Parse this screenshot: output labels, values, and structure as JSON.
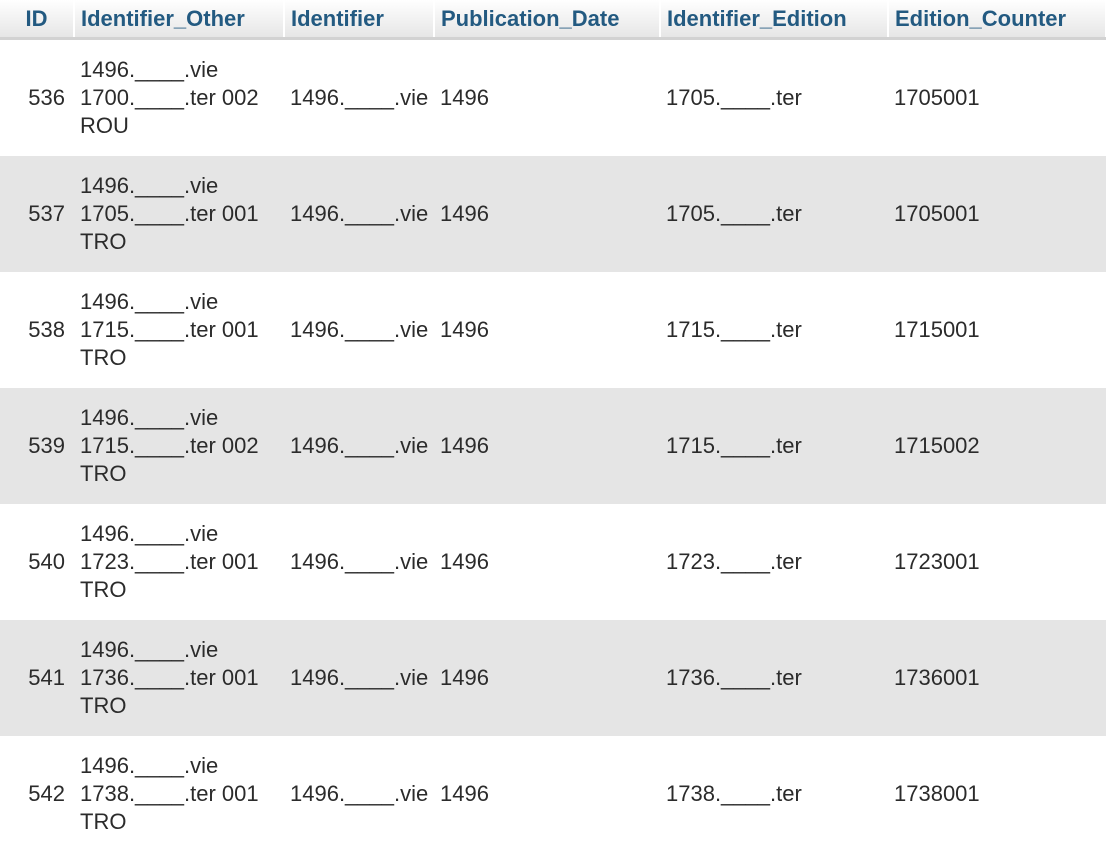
{
  "table": {
    "headers": {
      "id": "ID",
      "identifier_other": "Identifier_Other",
      "identifier": "Identifier",
      "publication_date": "Publication_Date",
      "identifier_edition": "Identifier_Edition",
      "edition_counter": "Edition_Counter"
    },
    "rows": [
      {
        "id": "536",
        "other": [
          "1496.____.vie",
          "1700.____.ter 002",
          "ROU"
        ],
        "identifier": "1496.____.vie",
        "pub_date": "1496",
        "edition": "1705.____.ter",
        "counter": "1705001"
      },
      {
        "id": "537",
        "other": [
          "1496.____.vie",
          "1705.____.ter 001",
          "TRO"
        ],
        "identifier": "1496.____.vie",
        "pub_date": "1496",
        "edition": "1705.____.ter",
        "counter": "1705001"
      },
      {
        "id": "538",
        "other": [
          "1496.____.vie",
          "1715.____.ter 001",
          "TRO"
        ],
        "identifier": "1496.____.vie",
        "pub_date": "1496",
        "edition": "1715.____.ter",
        "counter": "1715001"
      },
      {
        "id": "539",
        "other": [
          "1496.____.vie",
          "1715.____.ter 002",
          "TRO"
        ],
        "identifier": "1496.____.vie",
        "pub_date": "1496",
        "edition": "1715.____.ter",
        "counter": "1715002"
      },
      {
        "id": "540",
        "other": [
          "1496.____.vie",
          "1723.____.ter 001",
          "TRO"
        ],
        "identifier": "1496.____.vie",
        "pub_date": "1496",
        "edition": "1723.____.ter",
        "counter": "1723001"
      },
      {
        "id": "541",
        "other": [
          "1496.____.vie",
          "1736.____.ter 001",
          "TRO"
        ],
        "identifier": "1496.____.vie",
        "pub_date": "1496",
        "edition": "1736.____.ter",
        "counter": "1736001"
      },
      {
        "id": "542",
        "other": [
          "1496.____.vie",
          "1738.____.ter 001",
          "TRO"
        ],
        "identifier": "1496.____.vie",
        "pub_date": "1496",
        "edition": "1738.____.ter",
        "counter": "1738001"
      }
    ]
  }
}
